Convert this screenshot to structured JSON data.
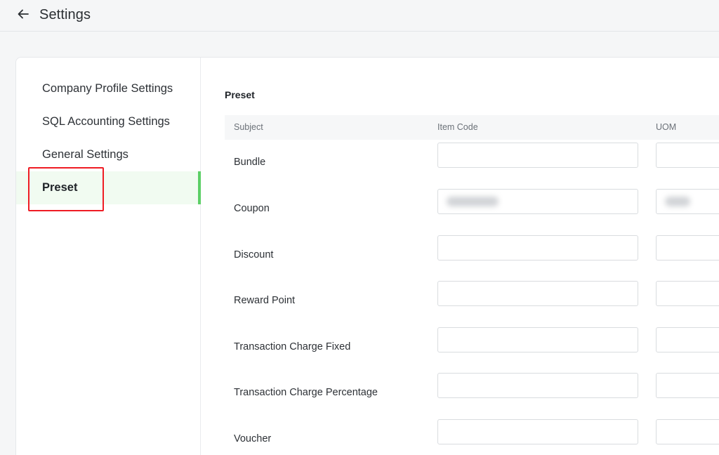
{
  "header": {
    "title": "Settings",
    "back_icon": "arrow-left-icon"
  },
  "sidebar": {
    "items": [
      {
        "label": "Company Profile Settings",
        "active": false
      },
      {
        "label": "SQL Accounting Settings",
        "active": false
      },
      {
        "label": "General Settings",
        "active": false
      },
      {
        "label": "Preset",
        "active": true
      }
    ]
  },
  "main": {
    "section_title": "Preset",
    "table": {
      "columns": [
        "Subject",
        "Item Code",
        "UOM"
      ],
      "rows": [
        {
          "subject": "Bundle",
          "item_code": "",
          "uom": ""
        },
        {
          "subject": "Coupon",
          "item_code": "",
          "uom": "",
          "item_code_redacted": true,
          "uom_redacted": true
        },
        {
          "subject": "Discount",
          "item_code": "",
          "uom": ""
        },
        {
          "subject": "Reward Point",
          "item_code": "",
          "uom": ""
        },
        {
          "subject": "Transaction Charge Fixed",
          "item_code": "",
          "uom": ""
        },
        {
          "subject": "Transaction Charge Percentage",
          "item_code": "",
          "uom": ""
        },
        {
          "subject": "Voucher",
          "item_code": "",
          "uom": ""
        }
      ]
    }
  },
  "colors": {
    "accent": "#5ccf66",
    "highlight": "#ef1c24",
    "active_bg": "#f1fbf1"
  }
}
